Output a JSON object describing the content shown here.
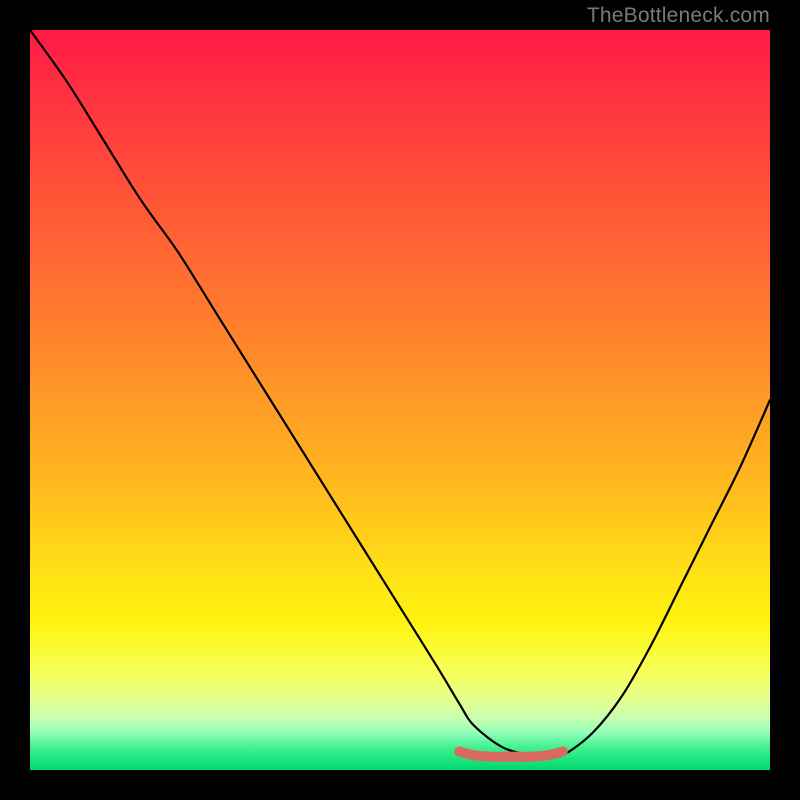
{
  "watermark": "TheBottleneck.com",
  "gradient_stops": {
    "c0": "#ff1a46",
    "c1": "#ff3a3e",
    "c2": "#ff5a36",
    "c3": "#ff7a2e",
    "c4": "#ff9a26",
    "c5": "#ffba1e",
    "c6": "#ffe016",
    "c7": "#fff20e",
    "c8": "#f8ff50",
    "c9": "#e8ff88",
    "c10": "#c8ffb0",
    "c11": "#90ffb8",
    "c12": "#40f090",
    "c13": "#00d870"
  },
  "chart_data": {
    "type": "line",
    "title": "",
    "xlabel": "",
    "ylabel": "",
    "xlim": [
      0,
      100
    ],
    "ylim": [
      0,
      100
    ],
    "series": [
      {
        "name": "bottleneck-curve",
        "color": "#000000",
        "x": [
          0,
          5,
          10,
          15,
          20,
          25,
          30,
          35,
          40,
          45,
          50,
          55,
          58,
          60,
          64,
          68,
          70,
          72,
          76,
          80,
          84,
          88,
          92,
          96,
          100
        ],
        "values": [
          100,
          93,
          85,
          77,
          70,
          62,
          54,
          46,
          38,
          30,
          22,
          14,
          9,
          6,
          3,
          2,
          2,
          2,
          5,
          10,
          17,
          25,
          33,
          41,
          50
        ]
      },
      {
        "name": "optimal-range-marker",
        "color": "#d96a60",
        "x": [
          58,
          60,
          62,
          64,
          66,
          68,
          70,
          72
        ],
        "values": [
          2.5,
          2.0,
          1.8,
          1.8,
          1.8,
          1.8,
          2.0,
          2.5
        ]
      }
    ],
    "grid": false,
    "legend_position": "none",
    "annotations": []
  }
}
